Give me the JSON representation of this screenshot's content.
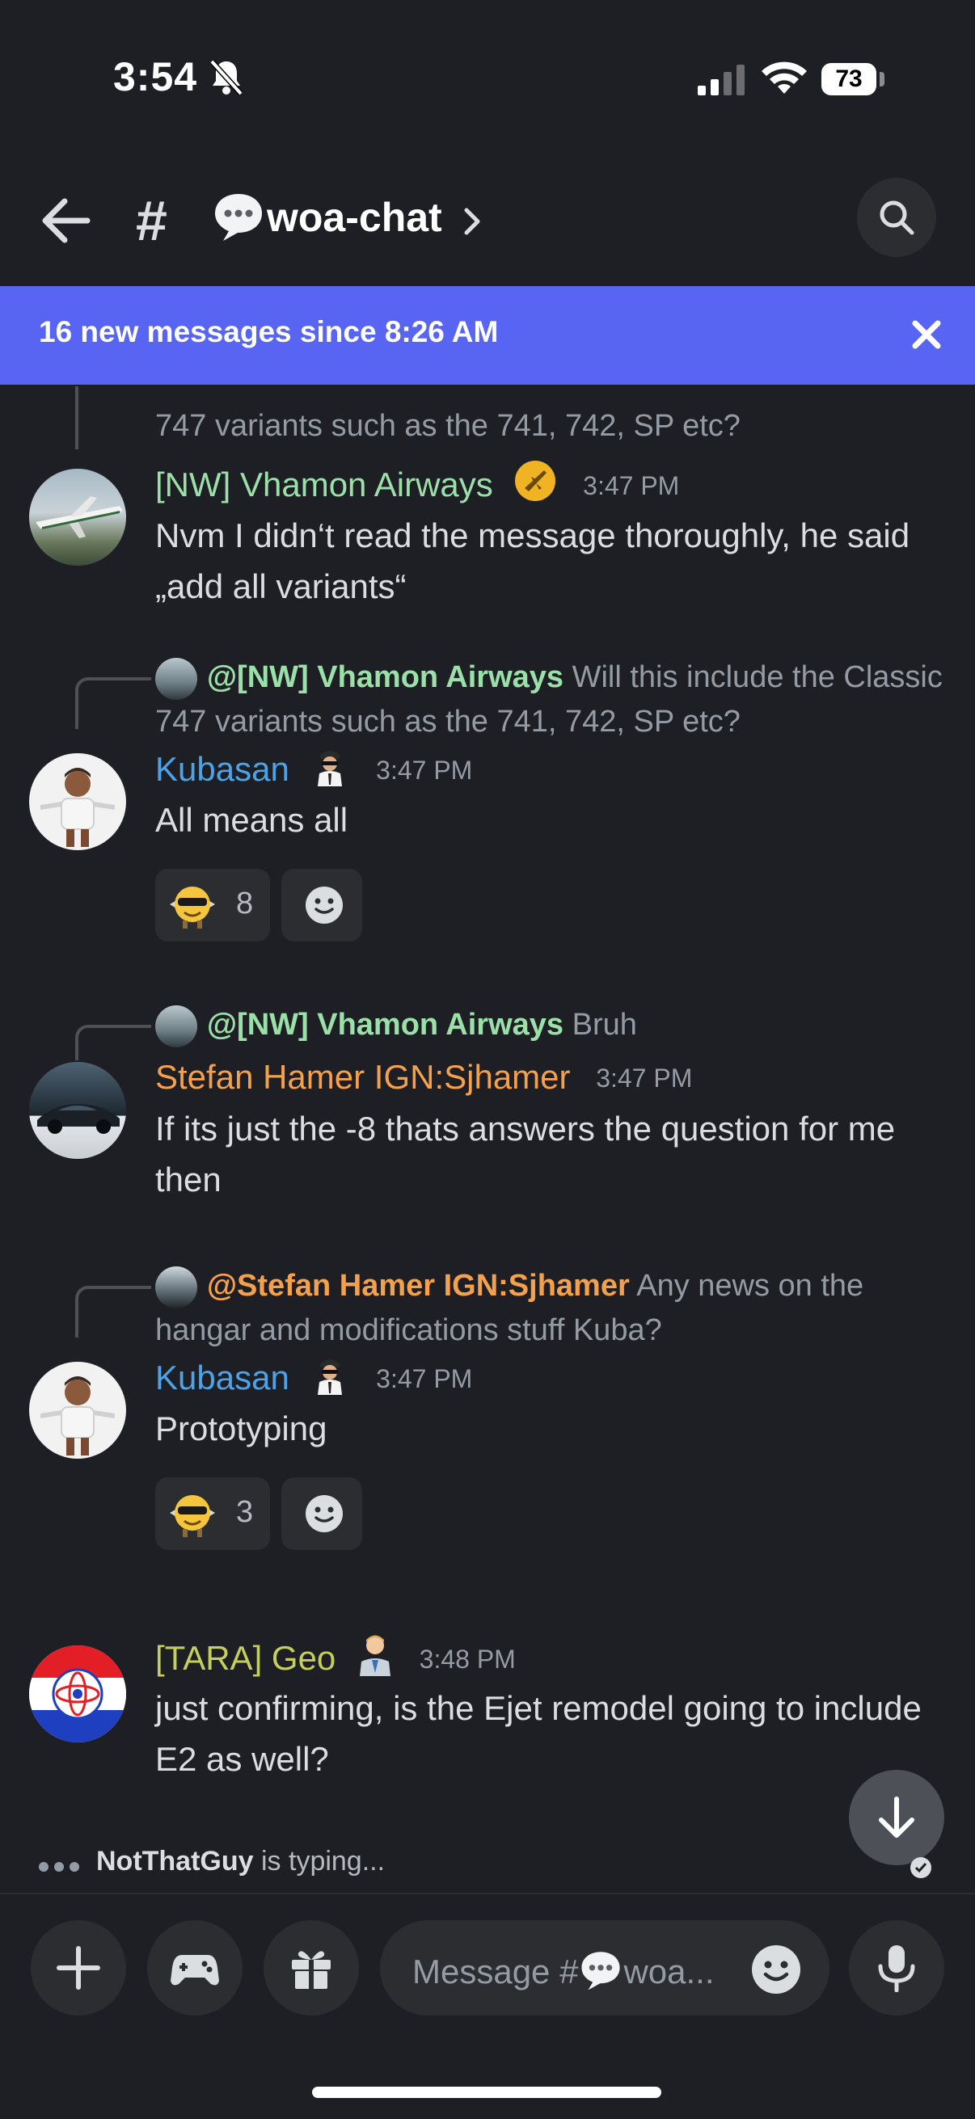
{
  "status_bar": {
    "time": "3:54",
    "battery": "73"
  },
  "header": {
    "channel_name": "woa-chat"
  },
  "banner": {
    "text": "16 new messages since 8:26 AM"
  },
  "messages": [
    {
      "reply_author": "[NW] Vhamon Airways",
      "reply_text": "Will this include the Classic 747 variants such as the 741, 742, SP etc?",
      "continuation_text": "747 variants such as the 741, 742, SP etc?",
      "author": "[NW] Vhamon Airways",
      "time": "3:47 PM",
      "content": "Nvm I didn‘t read the message thoroughly, he said „add all variants“"
    },
    {
      "reply_author": "@[NW] Vhamon Airways",
      "reply_text": "Will this include the Classic 747 variants such as the 741, 742, SP etc?",
      "author": "Kubasan",
      "time": "3:47 PM",
      "content": "All means all",
      "reactions": [
        {
          "count": "8"
        }
      ]
    },
    {
      "reply_author": "@[NW] Vhamon Airways",
      "reply_text": "Bruh",
      "author": "Stefan Hamer IGN:Sjhamer",
      "time": "3:47 PM",
      "content": "If its just the -8 thats answers the question for me then"
    },
    {
      "reply_author": "@Stefan Hamer IGN:Sjhamer",
      "reply_text": "Any news on the hangar and modifications stuff Kuba?",
      "author": "Kubasan",
      "time": "3:47 PM",
      "content": "Prototyping",
      "reactions": [
        {
          "count": "3"
        }
      ]
    },
    {
      "author": "[TARA] Geo",
      "time": "3:48 PM",
      "content": "just confirming, is the Ejet remodel going to include E2 as well?"
    }
  ],
  "typing": {
    "name": "NotThatGuy",
    "suffix": " is typing..."
  },
  "composer": {
    "placeholder_prefix": "Message #",
    "placeholder_suffix": "woa..."
  },
  "colors": {
    "background": "#1e1f24",
    "banner": "#5865f2",
    "green_role": "#9be0a8",
    "blue_role": "#4da3e8",
    "orange_role": "#f5a04b",
    "olive_role": "#c5cf5b"
  },
  "icons": [
    "bell-slash-icon",
    "signal-icon",
    "wifi-icon",
    "back-arrow-icon",
    "hash-icon",
    "speech-bubble-emoji",
    "chevron-right-icon",
    "search-icon",
    "close-icon",
    "airplane-badge-icon",
    "pilot-badge-icon",
    "suit-badge-icon",
    "cool-emoji-reaction",
    "add-reaction-icon",
    "arrow-down-icon",
    "plus-icon",
    "gamepad-icon",
    "gift-icon",
    "emoji-icon",
    "microphone-icon"
  ]
}
